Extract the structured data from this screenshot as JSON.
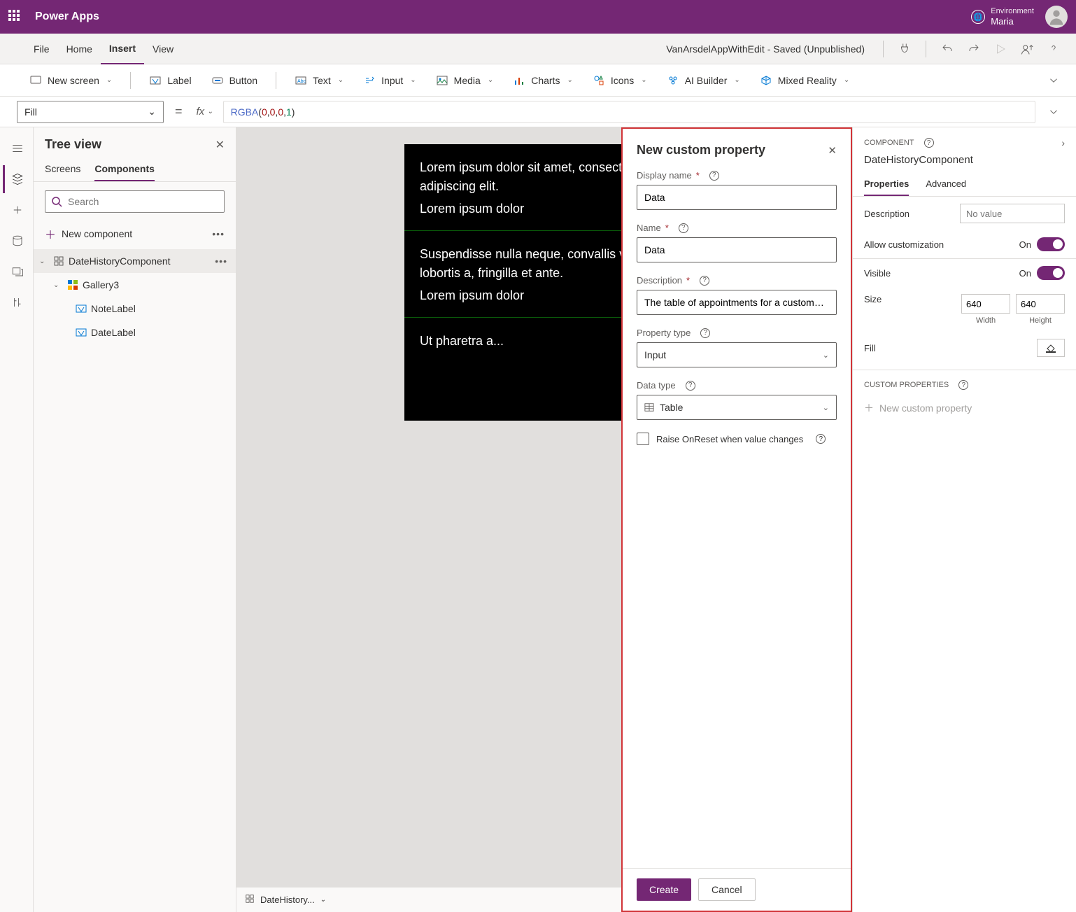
{
  "header": {
    "app_title": "Power Apps",
    "env_label": "Environment",
    "env_name": "Maria"
  },
  "menubar": {
    "items": [
      "File",
      "Home",
      "Insert",
      "View"
    ],
    "doc_title": "VanArsdelAppWithEdit - Saved (Unpublished)"
  },
  "toolbar": {
    "new_screen": "New screen",
    "label": "Label",
    "button": "Button",
    "text": "Text",
    "input": "Input",
    "media": "Media",
    "charts": "Charts",
    "icons": "Icons",
    "ai_builder": "AI Builder",
    "mixed_reality": "Mixed Reality"
  },
  "formulabar": {
    "property": "Fill",
    "formula_fn": "RGBA",
    "formula_args": [
      "0",
      "0",
      "0",
      "1"
    ]
  },
  "tree": {
    "title": "Tree view",
    "tabs": [
      "Screens",
      "Components"
    ],
    "search_placeholder": "Search",
    "new_component": "New component",
    "items": {
      "root": "DateHistoryComponent",
      "gallery": "Gallery3",
      "note_label": "NoteLabel",
      "date_label": "DateLabel"
    }
  },
  "canvas": {
    "note1": "Lorem ipsum dolor sit amet, consectetur adipiscing elit.",
    "date1": "Lorem ipsum dolor",
    "note2": "Suspendisse nulla neque, convallis vel lobortis a, fringilla et ante.",
    "date2": "Lorem ipsum dolor",
    "note3": "Ut pharetra a...",
    "footer_label": "DateHistory..."
  },
  "dialog": {
    "title": "New custom property",
    "display_name_label": "Display name",
    "display_name_value": "Data",
    "name_label": "Name",
    "name_value": "Data",
    "description_label": "Description",
    "description_value": "The table of appointments for a customer, sho...",
    "property_type_label": "Property type",
    "property_type_value": "Input",
    "data_type_label": "Data type",
    "data_type_value": "Table",
    "onreset_label": "Raise OnReset when value changes",
    "create": "Create",
    "cancel": "Cancel"
  },
  "rpanel": {
    "section": "COMPONENT",
    "component_name": "DateHistoryComponent",
    "tabs": [
      "Properties",
      "Advanced"
    ],
    "description_label": "Description",
    "description_placeholder": "No value",
    "allow_label": "Allow customization",
    "allow_value": "On",
    "visible_label": "Visible",
    "visible_value": "On",
    "size_label": "Size",
    "width_value": "640",
    "height_value": "640",
    "width_label": "Width",
    "height_label": "Height",
    "fill_label": "Fill",
    "custom_section": "CUSTOM PROPERTIES",
    "new_custom_prop": "New custom property"
  }
}
